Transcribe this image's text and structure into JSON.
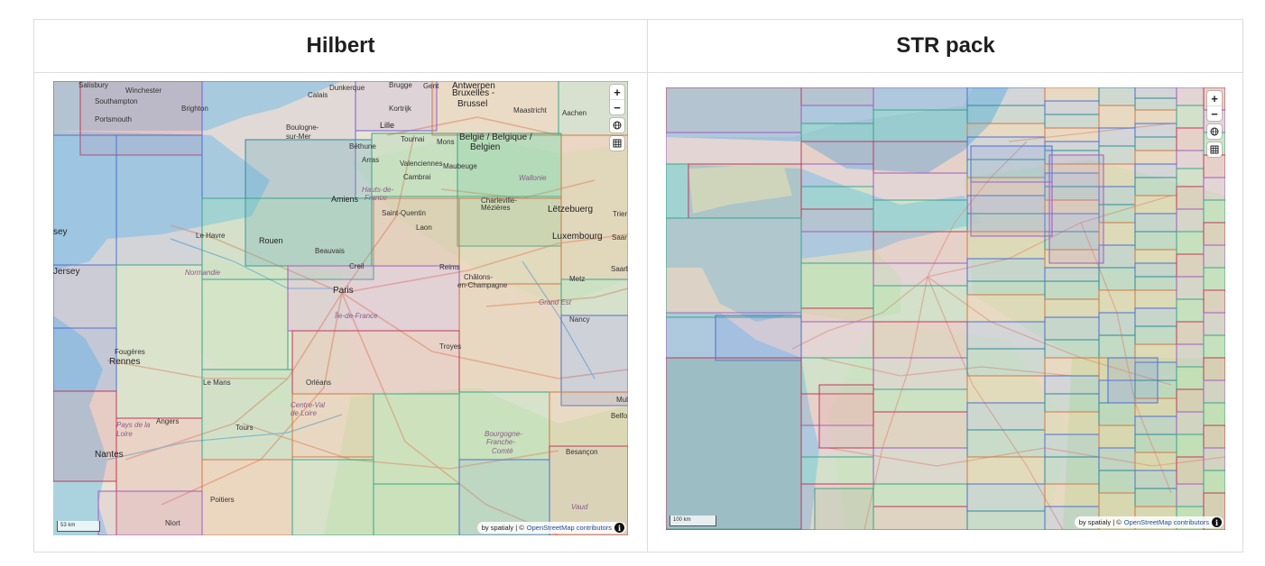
{
  "columns": [
    {
      "title": "Hilbert",
      "scale_label": "53 km",
      "attribution": {
        "by": "by spatialy | ©",
        "osm": "OpenStreetMap contributors"
      },
      "labels": [
        {
          "text": "Salisbury",
          "cls": "lbl"
        },
        {
          "text": "Winchester",
          "cls": "lbl"
        },
        {
          "text": "Southampton",
          "cls": "lbl"
        },
        {
          "text": "Portsmouth",
          "cls": "lbl"
        },
        {
          "text": "Brighton",
          "cls": "lbl"
        },
        {
          "text": "Calais",
          "cls": "lbl"
        },
        {
          "text": "Dunkerque",
          "cls": "lbl"
        },
        {
          "text": "Brugge",
          "cls": "lbl"
        },
        {
          "text": "Gent",
          "cls": "lbl"
        },
        {
          "text": "Antwerpen",
          "cls": "lbl big"
        },
        {
          "text": "Bruxelles -",
          "cls": "lbl big"
        },
        {
          "text": "Brussel",
          "cls": "lbl big"
        },
        {
          "text": "Maastricht",
          "cls": "lbl"
        },
        {
          "text": "Aachen",
          "cls": "lbl"
        },
        {
          "text": "Kortrijk",
          "cls": "lbl"
        },
        {
          "text": "Lille",
          "cls": "lbl city"
        },
        {
          "text": "Boulogne-",
          "cls": "lbl"
        },
        {
          "text": "sur-Mer",
          "cls": "lbl"
        },
        {
          "text": "Tournai",
          "cls": "lbl"
        },
        {
          "text": "Mons",
          "cls": "lbl"
        },
        {
          "text": "België / Belgique /",
          "cls": "lbl big"
        },
        {
          "text": "Belgien",
          "cls": "lbl big"
        },
        {
          "text": "Béthune",
          "cls": "lbl"
        },
        {
          "text": "Arras",
          "cls": "lbl"
        },
        {
          "text": "Valenciennes",
          "cls": "lbl"
        },
        {
          "text": "Maubeuge",
          "cls": "lbl"
        },
        {
          "text": "Cambrai",
          "cls": "lbl"
        },
        {
          "text": "Wallonie",
          "cls": "lbl region"
        },
        {
          "text": "Hauts-de-",
          "cls": "lbl region"
        },
        {
          "text": "France",
          "cls": "lbl region"
        },
        {
          "text": "Amiens",
          "cls": "lbl city"
        },
        {
          "text": "Charleville-",
          "cls": "lbl"
        },
        {
          "text": "Mézières",
          "cls": "lbl"
        },
        {
          "text": "Lëtzebuerg",
          "cls": "lbl big"
        },
        {
          "text": "Saint-Quentin",
          "cls": "lbl"
        },
        {
          "text": "Laon",
          "cls": "lbl"
        },
        {
          "text": "Luxembourg",
          "cls": "lbl big"
        },
        {
          "text": "Le Havre",
          "cls": "lbl"
        },
        {
          "text": "Rouen",
          "cls": "lbl city"
        },
        {
          "text": "Beauvais",
          "cls": "lbl"
        },
        {
          "text": "Trier",
          "cls": "lbl"
        },
        {
          "text": "Saar",
          "cls": "lbl"
        },
        {
          "text": "Saarb",
          "cls": "lbl"
        },
        {
          "text": "sey",
          "cls": "lbl big"
        },
        {
          "text": "Jersey",
          "cls": "lbl big"
        },
        {
          "text": "Normandie",
          "cls": "lbl region"
        },
        {
          "text": "Creil",
          "cls": "lbl"
        },
        {
          "text": "Reims",
          "cls": "lbl"
        },
        {
          "text": "Châlons-",
          "cls": "lbl"
        },
        {
          "text": "en-Champagne",
          "cls": "lbl"
        },
        {
          "text": "Metz",
          "cls": "lbl"
        },
        {
          "text": "Paris",
          "cls": "lbl big"
        },
        {
          "text": "Grand Est",
          "cls": "lbl region"
        },
        {
          "text": "Île-de-France",
          "cls": "lbl region"
        },
        {
          "text": "Nancy",
          "cls": "lbl"
        },
        {
          "text": "Troyes",
          "cls": "lbl"
        },
        {
          "text": "Fougères",
          "cls": "lbl"
        },
        {
          "text": "Rennes",
          "cls": "lbl big"
        },
        {
          "text": "Le Mans",
          "cls": "lbl"
        },
        {
          "text": "Orléans",
          "cls": "lbl"
        },
        {
          "text": "Mul",
          "cls": "lbl"
        },
        {
          "text": "Centre-Val",
          "cls": "lbl region"
        },
        {
          "text": "de Loire",
          "cls": "lbl region"
        },
        {
          "text": "Belfo",
          "cls": "lbl"
        },
        {
          "text": "Angers",
          "cls": "lbl"
        },
        {
          "text": "Pays de la",
          "cls": "lbl region"
        },
        {
          "text": "Loire",
          "cls": "lbl region"
        },
        {
          "text": "Tours",
          "cls": "lbl"
        },
        {
          "text": "Bourgogne-",
          "cls": "lbl region"
        },
        {
          "text": "Franche-",
          "cls": "lbl region"
        },
        {
          "text": "Comté",
          "cls": "lbl region"
        },
        {
          "text": "Nantes",
          "cls": "lbl big"
        },
        {
          "text": "Besançon",
          "cls": "lbl"
        },
        {
          "text": "Poitiers",
          "cls": "lbl"
        },
        {
          "text": "Vaud",
          "cls": "lbl region"
        },
        {
          "text": "Niort",
          "cls": "lbl"
        }
      ]
    },
    {
      "title": "STR pack",
      "scale_label": "100 km",
      "attribution": {
        "by": "by spatialy | ©",
        "osm": "OpenStreetMap contributors"
      },
      "labels": []
    }
  ],
  "controls": {
    "zoom_in": "+",
    "zoom_out": "−",
    "globe_icon": "globe-icon",
    "grid_icon": "grid-icon"
  },
  "info_glyph": "i"
}
